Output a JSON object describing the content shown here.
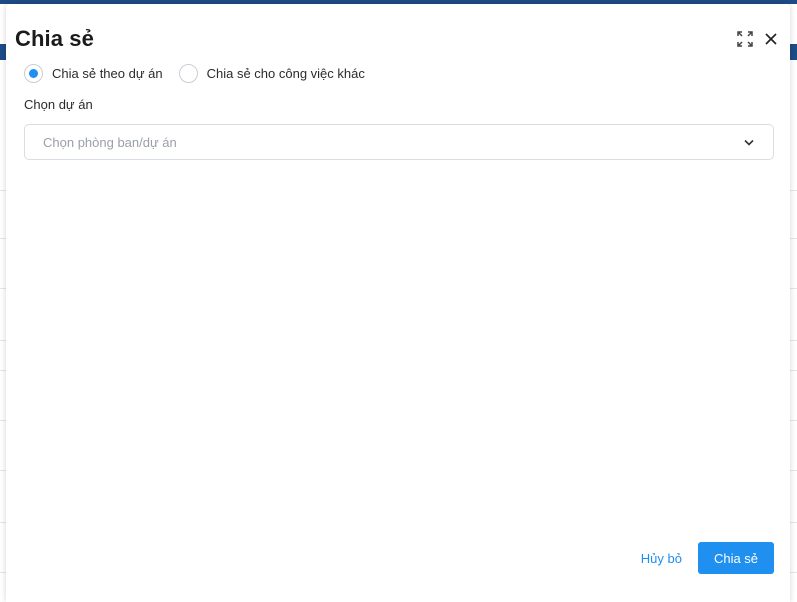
{
  "modal": {
    "title": "Chia sẻ",
    "expand_icon": "expand-icon",
    "close_icon": "close-icon"
  },
  "share_mode": {
    "options": [
      {
        "label": "Chia sẻ theo dự án",
        "checked": true
      },
      {
        "label": "Chia sẻ cho công việc khác",
        "checked": false
      }
    ]
  },
  "project_field": {
    "label": "Chọn dự án",
    "placeholder": "Chọn phòng ban/dự án",
    "chevron_icon": "chevron-down-icon"
  },
  "footer": {
    "cancel_label": "Hủy bỏ",
    "submit_label": "Chia sẻ"
  },
  "colors": {
    "accent": "#1f8ff0",
    "header_band": "#1e4b87"
  }
}
